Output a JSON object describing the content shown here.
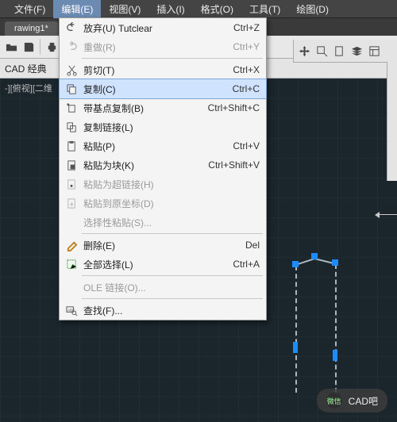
{
  "menubar": {
    "items": [
      {
        "label": "文件(F)"
      },
      {
        "label": "编辑(E)"
      },
      {
        "label": "视图(V)"
      },
      {
        "label": "插入(I)"
      },
      {
        "label": "格式(O)"
      },
      {
        "label": "工具(T)"
      },
      {
        "label": "绘图(D)"
      }
    ],
    "open_index": 1
  },
  "tab": {
    "label": "rawing1*"
  },
  "workspace": {
    "label": "CAD 经典"
  },
  "canvas_title": "-][俯视][二维",
  "edit_menu": {
    "items": [
      {
        "icon": "undo",
        "label": "放弃(U)  Tutclear",
        "shortcut": "Ctrl+Z",
        "disabled": false
      },
      {
        "icon": "redo",
        "label": "重做(R)",
        "shortcut": "Ctrl+Y",
        "disabled": true
      },
      {
        "sep": true
      },
      {
        "icon": "cut",
        "label": "剪切(T)",
        "shortcut": "Ctrl+X",
        "disabled": false
      },
      {
        "icon": "copy",
        "label": "复制(C)",
        "shortcut": "Ctrl+C",
        "disabled": false,
        "highlight": true
      },
      {
        "icon": "copybase",
        "label": "带基点复制(B)",
        "shortcut": "Ctrl+Shift+C",
        "disabled": false
      },
      {
        "icon": "copylink",
        "label": "复制链接(L)",
        "shortcut": "",
        "disabled": false
      },
      {
        "icon": "paste",
        "label": "粘贴(P)",
        "shortcut": "Ctrl+V",
        "disabled": false
      },
      {
        "icon": "pasteblock",
        "label": "粘贴为块(K)",
        "shortcut": "Ctrl+Shift+V",
        "disabled": false
      },
      {
        "icon": "pastelink",
        "label": "粘贴为超链接(H)",
        "shortcut": "",
        "disabled": true
      },
      {
        "icon": "pasteorig",
        "label": "粘贴到原坐标(D)",
        "shortcut": "",
        "disabled": true
      },
      {
        "icon": "pastesel",
        "label": "选择性粘贴(S)...",
        "shortcut": "",
        "disabled": true
      },
      {
        "sep": true
      },
      {
        "icon": "erase",
        "label": "删除(E)",
        "shortcut": "Del",
        "disabled": false
      },
      {
        "icon": "selall",
        "label": "全部选择(L)",
        "shortcut": "Ctrl+A",
        "disabled": false
      },
      {
        "sep": true
      },
      {
        "icon": "",
        "label": "OLE 链接(O)...",
        "shortcut": "",
        "disabled": true
      },
      {
        "sep": true
      },
      {
        "icon": "find",
        "label": "查找(F)...",
        "shortcut": "",
        "disabled": false
      }
    ]
  },
  "badge": {
    "logo": "微信",
    "text": "CAD吧"
  }
}
